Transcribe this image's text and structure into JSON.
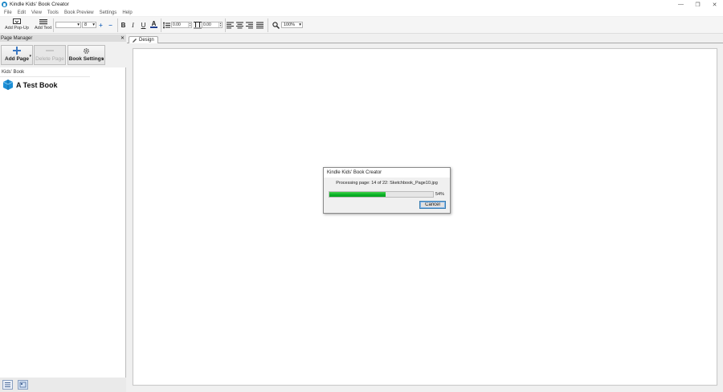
{
  "window": {
    "title": "Kindle Kids' Book Creator",
    "controls": {
      "minimize": "—",
      "restore": "❐",
      "close": "✕"
    }
  },
  "menu": [
    "File",
    "Edit",
    "View",
    "Tools",
    "Book Preview",
    "Settings",
    "Help"
  ],
  "toolbar": {
    "add_popup_label": "Add Pop-Up",
    "add_text_label": "Add Text",
    "font_family_value": "",
    "font_size_value": "8",
    "bold": "B",
    "italic": "I",
    "underline": "U",
    "font_color": "A",
    "line_spacing_value": "0.00",
    "char_spacing_value": "0.00",
    "zoom_value": "100%"
  },
  "page_manager": {
    "title": "Page Manager",
    "close": "✕",
    "add_page_label": "Add Page",
    "delete_page_label": "Delete Page",
    "book_settings_label": "Book Settings",
    "tree_root": "Kids' Book",
    "book_title": "A Test Book"
  },
  "design": {
    "tab_label": "Design"
  },
  "dialog": {
    "title": "Kindle Kids' Book Creator",
    "message": "Processing page: 14 of 22: Sketchbook_Page10.jpg",
    "progress": 54,
    "progress_text": "54%",
    "cancel_label": "Cancel"
  },
  "colors": {
    "accent": "#1e88c8",
    "progress_green": "#06b025"
  }
}
